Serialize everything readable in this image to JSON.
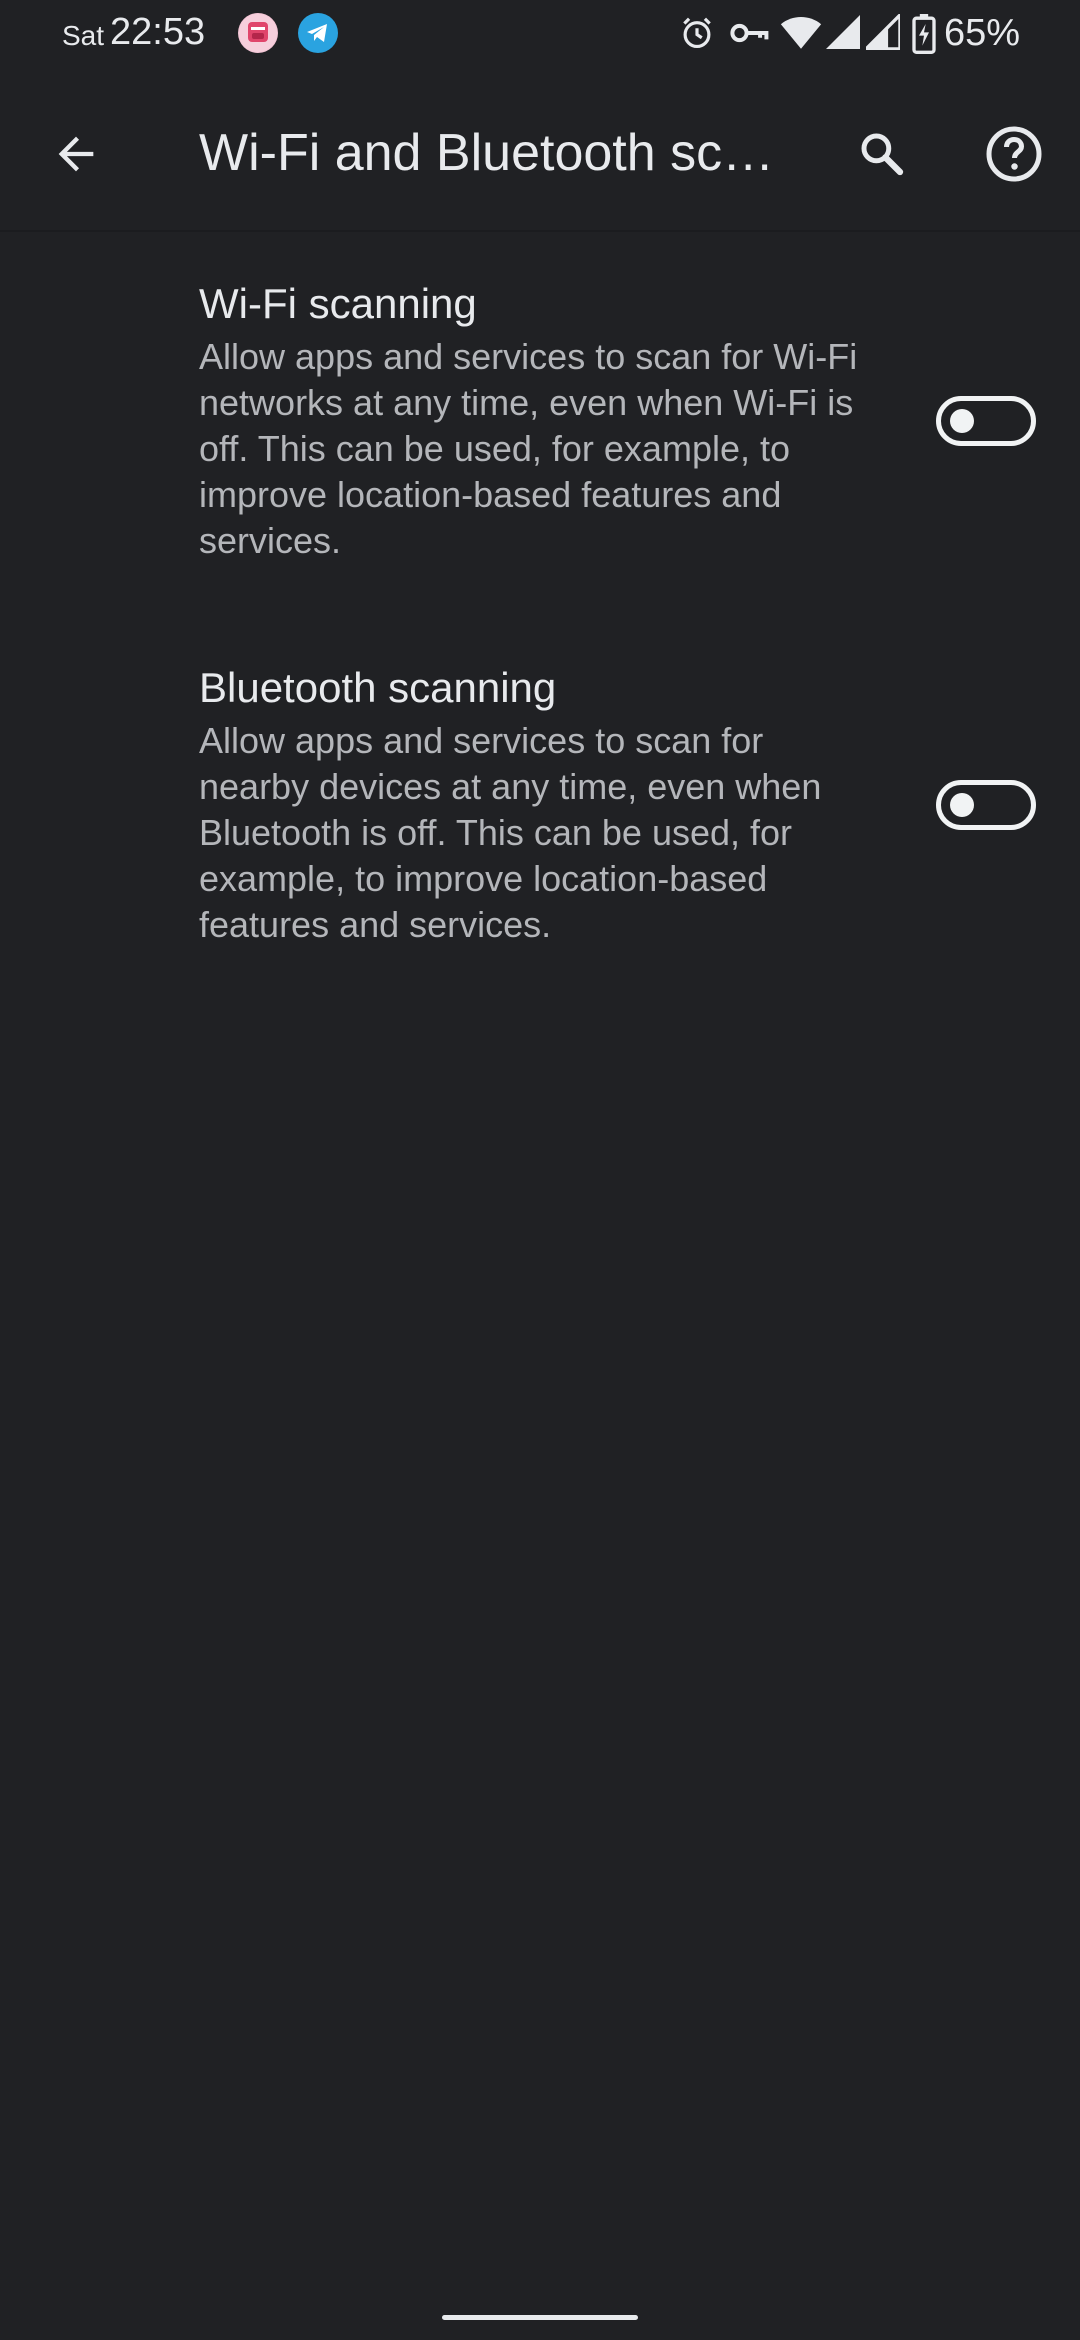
{
  "status_bar": {
    "day": "Sat",
    "time": "22:53",
    "battery_percent": "65%",
    "notification_icons": [
      "pink-app-icon",
      "telegram-icon"
    ],
    "system_icons": [
      "alarm-icon",
      "vpn-key-icon",
      "wifi-icon",
      "signal-icon",
      "signal-icon",
      "battery-charging-icon"
    ]
  },
  "app_bar": {
    "title": "Wi-Fi and Bluetooth sc…",
    "back_icon": "arrow-back-icon",
    "search_icon": "search-icon",
    "help_icon": "help-icon"
  },
  "settings": [
    {
      "title": "Wi-Fi scanning",
      "summary": "Allow apps and services to scan for Wi-Fi networks at any time, even when Wi-Fi is off. This can be used, for example, to improve location-based features and services.",
      "enabled": false
    },
    {
      "title": "Bluetooth scanning",
      "summary": "Allow apps and services to scan for nearby devices at any time, even when Bluetooth is off. This can be used, for example, to improve location-based features and services.",
      "enabled": false
    }
  ],
  "colors": {
    "background": "#202124",
    "text_primary": "#e8eaed",
    "text_secondary": "#b4b6ba",
    "telegram": "#2aa3e0"
  }
}
